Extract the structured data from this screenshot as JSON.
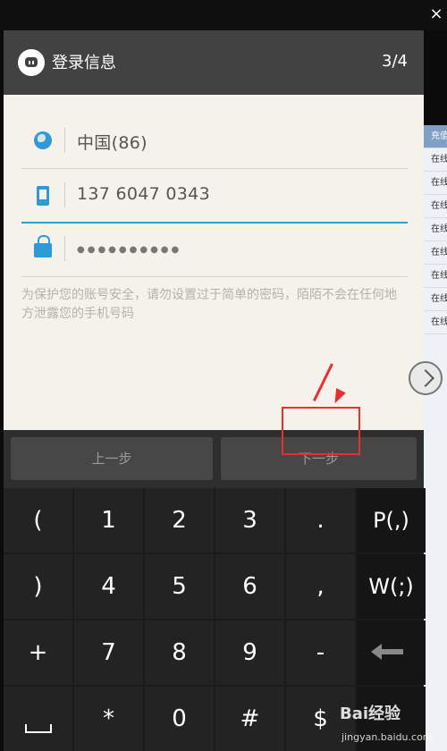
{
  "window": {
    "close_glyph": "×"
  },
  "background_app": {
    "rows": [
      "充值",
      "在线",
      "在线",
      "在线",
      "在线",
      "在线",
      "在线",
      "在线",
      "在线"
    ]
  },
  "header": {
    "title": "登录信息",
    "step": "3/4",
    "app_icon": "chat-bubble-icon"
  },
  "form": {
    "region": {
      "value": "中国(86)",
      "icon": "globe-icon"
    },
    "phone": {
      "value": "137 6047 0343",
      "icon": "phone-icon"
    },
    "password": {
      "value": "●●●●●●●●●●",
      "icon": "lock-icon"
    }
  },
  "hint": "为保护您的账号安全，请勿设置过于简单的密码，陌陌不会在任何地方泄露您的手机号码",
  "actions": {
    "prev_label": "上一步",
    "next_label": "下一步"
  },
  "keypad": {
    "rows": [
      [
        "(",
        "1",
        "2",
        "3",
        ".",
        "P(,)"
      ],
      [
        ")",
        "4",
        "5",
        "6",
        ",",
        "W(;)"
      ],
      [
        "+",
        "7",
        "8",
        "9",
        "-",
        "backspace"
      ],
      [
        "space",
        "*",
        "0",
        "#",
        "$",
        "enter"
      ]
    ]
  },
  "watermark": {
    "logo": "Bai经验",
    "url": "jingyan.baidu.com"
  },
  "colors": {
    "accent": "#2e9ad6",
    "header": "#424242",
    "highlight": "#e53030"
  }
}
